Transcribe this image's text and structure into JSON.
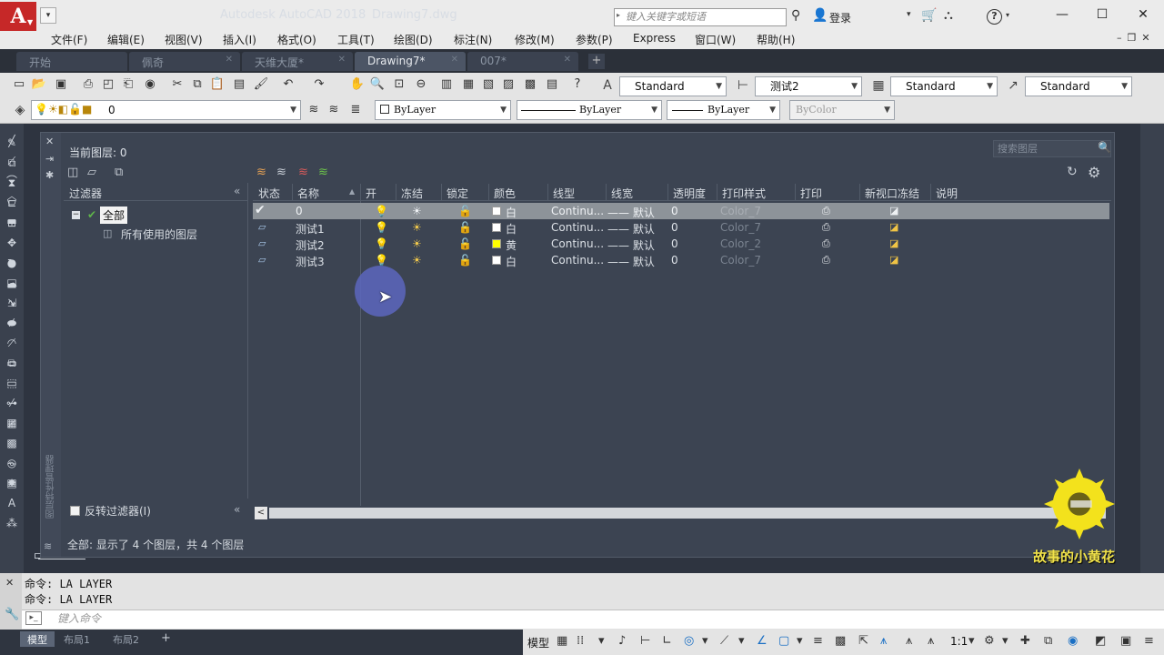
{
  "window": {
    "app_title": "Autodesk AutoCAD 2018",
    "file_title": "Drawing7.dwg",
    "search_placeholder": "键入关键字或短语",
    "login_label": "登录",
    "help_label": "?",
    "minimize": "—",
    "maximize": "☐",
    "close": "✕"
  },
  "menu": [
    "文件(F)",
    "编辑(E)",
    "视图(V)",
    "插入(I)",
    "格式(O)",
    "工具(T)",
    "绘图(D)",
    "标注(N)",
    "修改(M)",
    "参数(P)",
    "Express",
    "窗口(W)",
    "帮助(H)"
  ],
  "tabs": [
    {
      "label": "开始",
      "active": false
    },
    {
      "label": "佩奇",
      "active": false
    },
    {
      "label": "天维大厦*",
      "active": false
    },
    {
      "label": "Drawing7*",
      "active": true
    },
    {
      "label": "007*",
      "active": false
    }
  ],
  "toolbar": {
    "text_style": "Standard",
    "dim_style": "测试2",
    "table_style": "Standard",
    "mleader_style": "Standard",
    "layer_combo": "0",
    "color_combo": "ByLayer",
    "linetype_combo": "ByLayer",
    "lineweight_combo": "ByLayer",
    "plotstyle_combo": "ByColor"
  },
  "layer_manager": {
    "palette_title": "图层特性管理器",
    "current_layer": "当前图层: 0",
    "search_placeholder": "搜索图层",
    "filters_header": "过滤器",
    "tree_all": "全部",
    "tree_used": "所有使用的图层",
    "invert_filter": "反转过滤器(I)",
    "summary": "全部: 显示了 4 个图层，共 4 个图层",
    "columns": [
      "状态",
      "名称",
      "开",
      "冻结",
      "锁定",
      "颜色",
      "线型",
      "线宽",
      "透明度",
      "打印样式",
      "打印",
      "新视口冻结",
      "说明"
    ],
    "rows": [
      {
        "status": "current",
        "name": "0",
        "color_name": "白",
        "color_hex": "#ffffff",
        "linetype": "Continu...",
        "lineweight": "—— 默认",
        "transparency": "0",
        "plot_style": "Color_7",
        "selected": true
      },
      {
        "status": "layer",
        "name": "测试1",
        "color_name": "白",
        "color_hex": "#ffffff",
        "linetype": "Continu...",
        "lineweight": "—— 默认",
        "transparency": "0",
        "plot_style": "Color_7",
        "selected": false
      },
      {
        "status": "layer",
        "name": "测试2",
        "color_name": "黄",
        "color_hex": "#ffff00",
        "linetype": "Continu...",
        "lineweight": "—— 默认",
        "transparency": "0",
        "plot_style": "Color_2",
        "selected": false
      },
      {
        "status": "layer",
        "name": "测试3",
        "color_name": "白",
        "color_hex": "#ffffff",
        "linetype": "Continu...",
        "lineweight": "—— 默认",
        "transparency": "0",
        "plot_style": "Color_7",
        "selected": false
      }
    ]
  },
  "command": {
    "history": [
      "命令: LA LAYER",
      "命令: LA LAYER"
    ],
    "placeholder": "键入命令"
  },
  "statusbar": {
    "layouts": [
      {
        "label": "模型",
        "active": true
      },
      {
        "label": "布局1",
        "active": false
      },
      {
        "label": "布局2",
        "active": false
      }
    ],
    "model_label": "模型",
    "scale": "1:1"
  },
  "watermark": {
    "text": "故事的小黄花"
  },
  "colors": {
    "accent_check": "#6cc24a",
    "selected_row": "#8d9399",
    "palette_bg": "#3c4452",
    "logo_red": "#c62828"
  }
}
